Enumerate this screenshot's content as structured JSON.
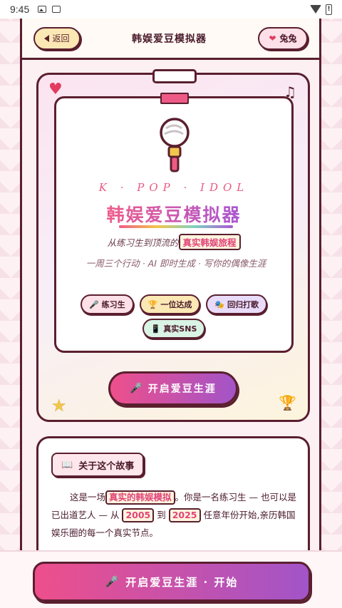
{
  "status": {
    "time": "9:45"
  },
  "topbar": {
    "back_label": "返回",
    "title": "韩娱爱豆模拟器",
    "user_name": "兔兔"
  },
  "hero": {
    "kpop_text": "K · POP · IDOL",
    "title": "韩娱爱豆模拟器",
    "subtitle_prefix": "从练习生到顶流的",
    "subtitle_highlight": "真实韩娱旅程",
    "subtitle2": "一周三个行动 · AI 即时生成 · 写你的偶像生涯",
    "tags": [
      {
        "icon": "🎤",
        "label": "练习生"
      },
      {
        "icon": "🏆",
        "label": "一位达成"
      },
      {
        "icon": "🎭",
        "label": "回归打歌"
      },
      {
        "icon": "📱",
        "label": "真实SNS"
      }
    ],
    "cta_icon": "🎤",
    "cta_label": "开启爱豆生涯"
  },
  "story": {
    "heading_icon": "📖",
    "heading": "关于这个故事",
    "p1_a": "这是一场",
    "p1_hl": "真实的韩娱模拟",
    "p1_b": "。你是一名练习生 — 也可以是已出道艺人 — 从",
    "year_start": "2005",
    "p1_c": "到",
    "year_end": "2025",
    "p1_d": "任意年份开始,亲历韩国娱乐圈的每一个真实节点。"
  },
  "bottom": {
    "cta_icon": "🎤",
    "cta_label": "开启爱豆生涯 · 开始"
  },
  "colors": {
    "accent_pink": "#ee4f8b",
    "accent_purple": "#a254c8",
    "outline": "#5a1f2f"
  }
}
